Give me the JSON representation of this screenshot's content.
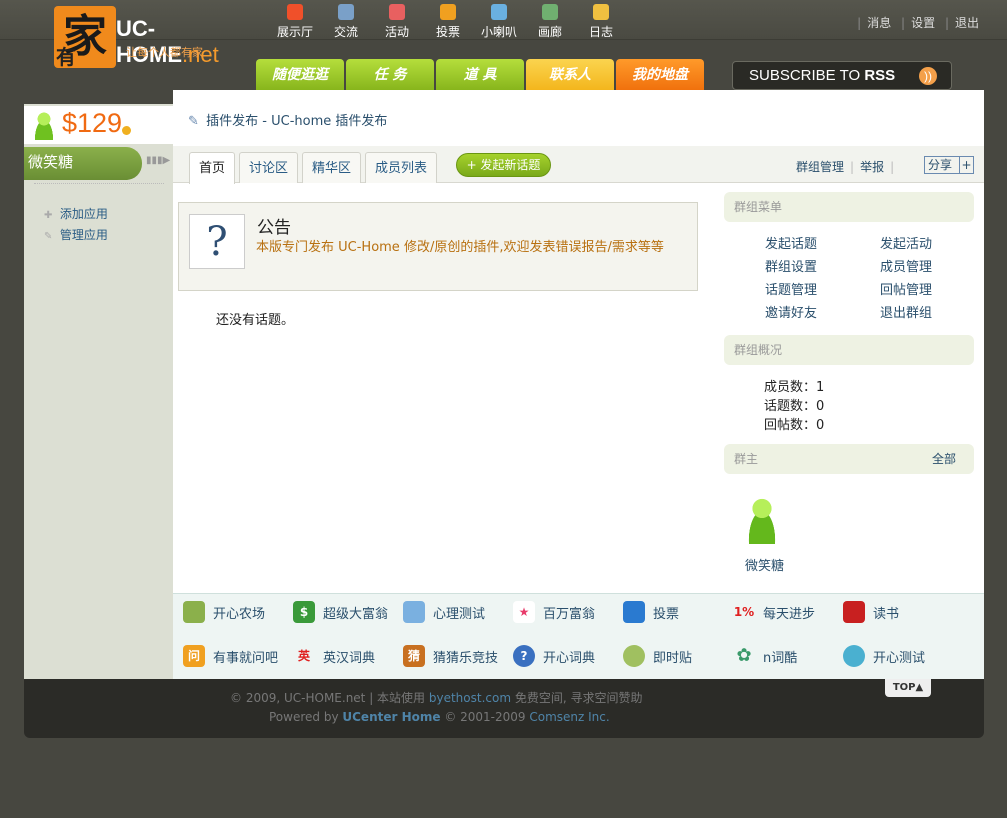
{
  "logo": {
    "seal": "家",
    "seal_small": "有",
    "brand": "UC-HOME",
    "brand_suffix": ".net",
    "slogan": "让每个人都有家"
  },
  "topnav": [
    {
      "label": "展示厅",
      "icon": "fire-icon",
      "color": "#f0502a"
    },
    {
      "label": "交流",
      "icon": "chat-icon",
      "color": "#7aa0c8"
    },
    {
      "label": "活动",
      "icon": "calendar-icon",
      "color": "#e86060"
    },
    {
      "label": "投票",
      "icon": "bar-chart-icon",
      "color": "#f0a020"
    },
    {
      "label": "小喇叭",
      "icon": "speech-bubble-icon",
      "color": "#6ab0e0"
    },
    {
      "label": "画廊",
      "icon": "picture-icon",
      "color": "#70b070"
    },
    {
      "label": "日志",
      "icon": "notepad-icon",
      "color": "#f0c040"
    }
  ],
  "toplinks": {
    "messages": "消息",
    "settings": "设置",
    "logout": "退出"
  },
  "maintabs": [
    {
      "label": "随便逛逛",
      "style": "green"
    },
    {
      "label": "任 务",
      "style": "green"
    },
    {
      "label": "道 具",
      "style": "green"
    },
    {
      "label": "联系人",
      "style": "yellow"
    },
    {
      "label": "我的地盘",
      "style": "orange"
    }
  ],
  "rss": {
    "prefix": "SUBSCRIBE TO ",
    "bold": "RSS"
  },
  "sidebar": {
    "money": "$129",
    "username": "微笑糖",
    "links": [
      {
        "label": "添加应用"
      },
      {
        "label": "管理应用"
      }
    ]
  },
  "breadcrumb": "插件发布 - UC-home 插件发布",
  "subtabs": [
    "首页",
    "讨论区",
    "精华区",
    "成员列表"
  ],
  "new_topic_button": "+ 发起新话题",
  "sub_actions": {
    "manage": "群组管理",
    "report": "举报",
    "share": "分享"
  },
  "notice": {
    "title": "公告",
    "body": "本版专门发布 UC-Home 修改/原创的插件,欢迎发表错误报告/需求等等"
  },
  "empty_text": "还没有话题。",
  "group_menu": {
    "title": "群组菜单",
    "items": [
      "发起话题",
      "发起活动",
      "群组设置",
      "成员管理",
      "话题管理",
      "回帖管理",
      "邀请好友",
      "退出群组"
    ]
  },
  "group_overview": {
    "title": "群组概况",
    "members": "成员数：1",
    "topics": "话题数：0",
    "replies": "回帖数：0"
  },
  "group_owner": {
    "title": "群主",
    "more": "全部",
    "name": "微笑糖"
  },
  "apps": [
    {
      "label": "开心农场",
      "icon": "sprout-icon",
      "bg": "#8bb04b",
      "glyph": ""
    },
    {
      "label": "超级大富翁",
      "icon": "dollar-icon",
      "bg": "#3a9a3a",
      "glyph": "$"
    },
    {
      "label": "心理测试",
      "icon": "flask-icon",
      "bg": "#7ab0e0",
      "glyph": ""
    },
    {
      "label": "百万富翁",
      "icon": "star-icon",
      "bg": "#e83a6a",
      "glyph": "★"
    },
    {
      "label": "投票",
      "icon": "bar-chart-icon",
      "bg": "#2a7ad0",
      "glyph": ""
    },
    {
      "label": "每天进步",
      "icon": "percent-icon",
      "bg": "#ffffff",
      "glyph": "1%"
    },
    {
      "label": "读书",
      "icon": "book-icon",
      "bg": "#c82020",
      "glyph": ""
    },
    {
      "label": "有事就问吧",
      "icon": "question-box-icon",
      "bg": "#f0a020",
      "glyph": "问"
    },
    {
      "label": "英汉词典",
      "icon": "english-icon",
      "bg": "#ffffff",
      "glyph": "英"
    },
    {
      "label": "猜猜乐竞技",
      "icon": "puzzle-icon",
      "bg": "#c87020",
      "glyph": "猜"
    },
    {
      "label": "开心词典",
      "icon": "help-circle-icon",
      "bg": "#3a70c0",
      "glyph": "?"
    },
    {
      "label": "即时贴",
      "icon": "sticky-note-icon",
      "bg": "#a0c060",
      "glyph": ""
    },
    {
      "label": "n词酷",
      "icon": "flower-icon",
      "bg": "#3a9a6a",
      "glyph": "✿"
    },
    {
      "label": "开心测试",
      "icon": "seahorse-icon",
      "bg": "#4ab0d0",
      "glyph": ""
    }
  ],
  "footer": {
    "line1_a": "© 2009, UC-HOME.net | 本站使用 ",
    "line1_link": "byethost.com",
    "line1_b": " 免费空间, 寻求空间赞助",
    "line2_a": "Powered by ",
    "line2_link": "UCenter Home",
    "line2_b": " © 2001-2009 ",
    "line2_link2": "Comsenz Inc."
  },
  "totop": "TOP▲"
}
